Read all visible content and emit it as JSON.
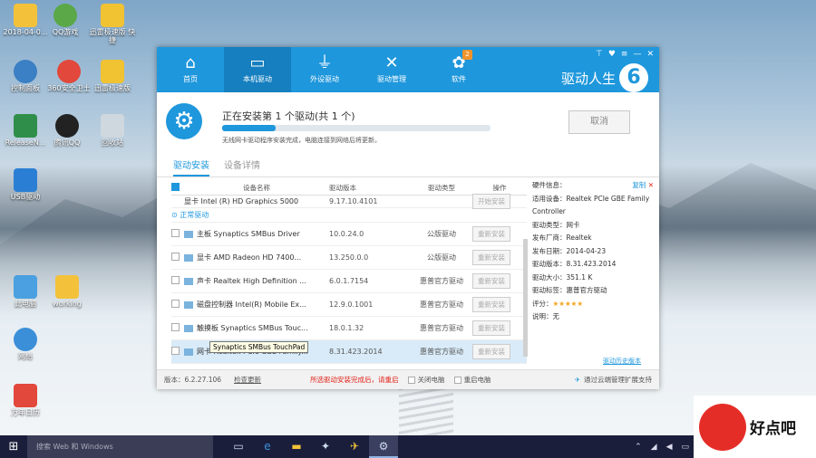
{
  "desktop": {
    "icons": [
      {
        "label": "2018-04-0..."
      },
      {
        "label": "QQ游戏"
      },
      {
        "label": "迅雷极速版 快捷"
      },
      {
        "label": "控制面板"
      },
      {
        "label": "360安全卫士"
      },
      {
        "label": "迅雷极速版"
      },
      {
        "label": "ReleaseN..."
      },
      {
        "label": "腾讯QQ"
      },
      {
        "label": "回收站"
      },
      {
        "label": "USB驱动"
      },
      {
        "label": "此电脑"
      },
      {
        "label": "working"
      },
      {
        "label": "网络"
      },
      {
        "label": "万年日历"
      }
    ]
  },
  "app": {
    "window_controls": {
      "pin": "⊤",
      "feedback": "♥",
      "menu": "≡",
      "minimize": "—",
      "close": "✕"
    },
    "nav": [
      {
        "label": "首页",
        "icon": "⌂"
      },
      {
        "label": "本机驱动",
        "icon": "▭"
      },
      {
        "label": "外设驱动",
        "icon": "⏚"
      },
      {
        "label": "驱动管理",
        "icon": "✕"
      },
      {
        "label": "软件",
        "icon": "✿",
        "badge": "2"
      }
    ],
    "brand": {
      "title": "驱动人生",
      "number": "6"
    },
    "status": {
      "title": "正在安装第 1 个驱动(共 1 个)",
      "progress": 0.2,
      "subtitle": "无线网卡驱动程序安装完成，电脑连接到网络后将更新。",
      "cancel_label": "取消"
    },
    "tabs": [
      {
        "label": "驱动安装"
      },
      {
        "label": "设备详情"
      }
    ],
    "table": {
      "headers": {
        "device": "设备名称",
        "version": "驱动版本",
        "type": "驱动类型",
        "action": "操作"
      },
      "first_row": {
        "name": "显卡 Intel (R) HD Graphics 5000",
        "version": "9.17.10.4101",
        "type": "",
        "action": "开始安装"
      },
      "group_label": "正常驱动",
      "rows": [
        {
          "name": "主板 Synaptics SMBus Driver",
          "version": "10.0.24.0",
          "type": "公版驱动",
          "action": "重新安装"
        },
        {
          "name": "显卡 AMD Radeon HD 7400...",
          "version": "13.250.0.0",
          "type": "公版驱动",
          "action": "重新安装"
        },
        {
          "name": "声卡 Realtek High Definition ...",
          "version": "6.0.1.7154",
          "type": "惠普官方驱动",
          "action": "重新安装"
        },
        {
          "name": "磁盘控制器 Intel(R) Mobile Ex...",
          "version": "12.9.0.1001",
          "type": "惠普官方驱动",
          "action": "重新安装"
        },
        {
          "name": "触摸板 Synaptics SMBus Touc...",
          "version": "18.0.1.32",
          "type": "惠普官方驱动",
          "action": "重新安装"
        },
        {
          "name": "网卡 Realtek PCIe GBE Family...",
          "version": "8.31.423.2014",
          "type": "惠普官方驱动",
          "action": "重新安装"
        }
      ],
      "tooltip": "Synaptics SMBus TouchPad"
    },
    "detail": {
      "header_label": "硬件信息：",
      "header_link": "复制",
      "lines": [
        "适用设备：Realtek PCIe GBE Family Controller",
        "驱动类型：网卡",
        "发布厂商：Realtek",
        "发布日期：2014-04-23",
        "驱动版本：8.31.423.2014",
        "驱动大小：351.1 K",
        "驱动标签：惠普官方驱动"
      ],
      "rating_label": "评分：",
      "stars": "★★★★★",
      "note": "说明：无",
      "link": "驱动历史版本"
    },
    "footer": {
      "version": "版本：6.2.27.106",
      "check_update": "检查更新",
      "warning": "所选驱动安装完成后，请重启",
      "restart_option": "关闭电脑",
      "shutdown_option": "重启电脑",
      "cloud": "通过云端管理扩展支持"
    }
  },
  "taskbar": {
    "search_placeholder": "搜索 Web 和 Windows"
  },
  "watermark": {
    "text": "好点吧"
  }
}
